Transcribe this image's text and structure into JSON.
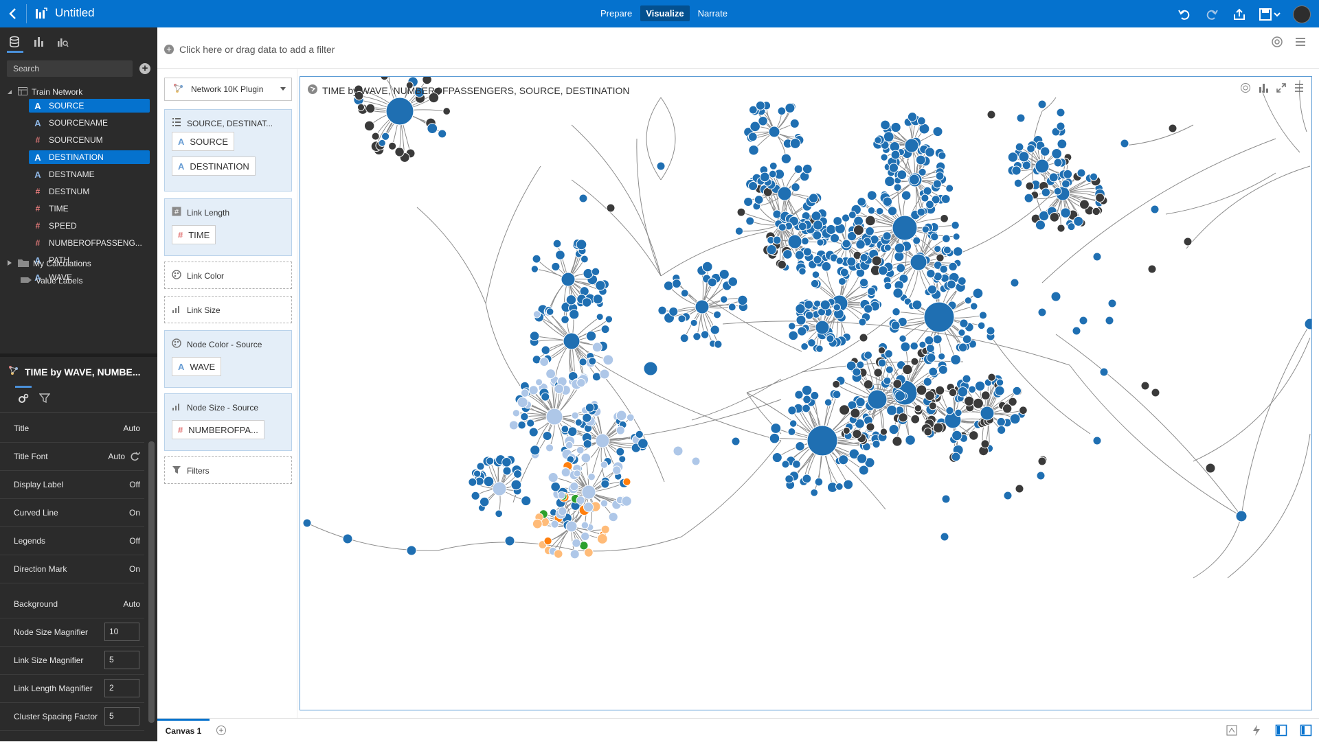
{
  "app": {
    "title": "Untitled",
    "modes": [
      "Prepare",
      "Visualize",
      "Narrate"
    ],
    "active_mode": "Visualize"
  },
  "left_panel": {
    "search_placeholder": "Search",
    "dataset": "Train Network",
    "fields": [
      {
        "label": "SOURCE",
        "type": "attribute",
        "selected": true
      },
      {
        "label": "SOURCENAME",
        "type": "attribute",
        "selected": false
      },
      {
        "label": "SOURCENUM",
        "type": "measure",
        "selected": false
      },
      {
        "label": "DESTINATION",
        "type": "attribute",
        "selected": true
      },
      {
        "label": "DESTNAME",
        "type": "attribute",
        "selected": false
      },
      {
        "label": "DESTNUM",
        "type": "measure",
        "selected": false
      },
      {
        "label": "TIME",
        "type": "measure",
        "selected": false
      },
      {
        "label": "SPEED",
        "type": "measure",
        "selected": false
      },
      {
        "label": "NUMBEROFPASSENG...",
        "type": "measure",
        "selected": false
      },
      {
        "label": "PATH",
        "type": "attribute",
        "selected": false
      },
      {
        "label": "WAVE",
        "type": "attribute",
        "selected": false
      }
    ],
    "my_calculations": "My Calculations",
    "value_labels": "Value Labels"
  },
  "properties": {
    "title": "TIME by WAVE, NUMBE...",
    "rows": [
      {
        "name": "Title",
        "value": "Auto",
        "kind": "text"
      },
      {
        "name": "Title Font",
        "value": "Auto",
        "kind": "font"
      },
      {
        "name": "Display Label",
        "value": "Off",
        "kind": "text"
      },
      {
        "name": "Curved Line",
        "value": "On",
        "kind": "text"
      },
      {
        "name": "Legends",
        "value": "Off",
        "kind": "text"
      },
      {
        "name": "Direction Mark",
        "value": "On",
        "kind": "text"
      },
      {
        "name": "Background",
        "value": "Auto",
        "kind": "text"
      },
      {
        "name": "Node Size Magnifier",
        "value": "10",
        "kind": "input"
      },
      {
        "name": "Link Size Magnifier",
        "value": "5",
        "kind": "input"
      },
      {
        "name": "Link Length Magnifier",
        "value": "2",
        "kind": "input"
      },
      {
        "name": "Cluster Spacing Factor",
        "value": "5",
        "kind": "input"
      }
    ]
  },
  "filter_bar": {
    "placeholder": "Click here or drag data to add a filter"
  },
  "grammar": {
    "plugin": "Network 10K Plugin",
    "sections": [
      {
        "head": "SOURCE, DESTINAT...",
        "chips": [
          {
            "label": "SOURCE",
            "type": "attribute"
          },
          {
            "label": "DESTINATION",
            "type": "attribute"
          }
        ]
      },
      {
        "head": "Link Length",
        "chips": [
          {
            "label": "TIME",
            "type": "measure"
          }
        ]
      },
      {
        "head": "Link Color",
        "chips": []
      },
      {
        "head": "Link Size",
        "chips": []
      },
      {
        "head": "Node Color - Source",
        "chips": [
          {
            "label": "WAVE",
            "type": "attribute"
          }
        ]
      },
      {
        "head": "Node Size - Source",
        "chips": [
          {
            "label": "NUMBEROFPA...",
            "type": "measure"
          }
        ]
      },
      {
        "head": "Filters",
        "chips": []
      }
    ]
  },
  "viz": {
    "title": "TIME by WAVE, NUMBEROFPASSENGERS, SOURCE, DESTINATION",
    "colors": {
      "blue": "#1f6fb2",
      "light_blue": "#aec7e8",
      "orange": "#ff7f0e",
      "light_orange": "#ffbb78",
      "green": "#2ca02c",
      "dark": "#3a3a3a",
      "edge": "#8c8c8c"
    }
  },
  "bottom": {
    "canvas_tab": "Canvas 1"
  }
}
